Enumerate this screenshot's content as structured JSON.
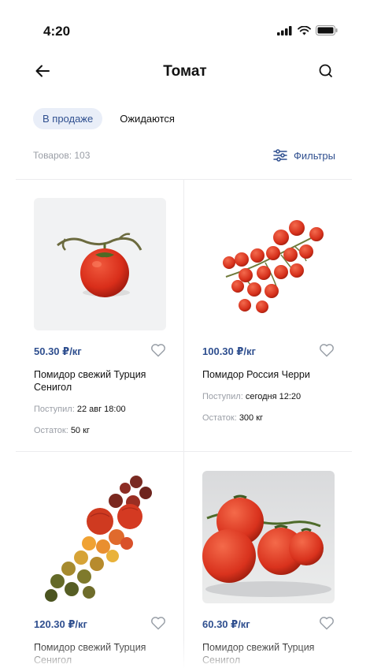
{
  "status": {
    "time": "4:20"
  },
  "header": {
    "title": "Томат"
  },
  "tabs": [
    {
      "label": "В продаже"
    },
    {
      "label": "Ожидаются"
    }
  ],
  "toolbar": {
    "count_label": "Товаров: 103",
    "filters_label": "Фильтры"
  },
  "colors": {
    "accent": "#2f4f8f",
    "chip_bg": "#e9eef8",
    "muted": "#9a9ea6"
  },
  "products": [
    {
      "price": "50.30 ₽/кг",
      "name": "Помидор свежий Турция Сенигол",
      "arrived_label": "Поступил:",
      "arrived_value": "22 авг 18:00",
      "stock_label": "Остаток:",
      "stock_value": "50 кг"
    },
    {
      "price": "100.30 ₽/кг",
      "name": "Помидор  Россия Черри",
      "arrived_label": "Поступил:",
      "arrived_value": "сегодня 12:20",
      "stock_label": "Остаток:",
      "stock_value": "300 кг"
    },
    {
      "price": "120.30 ₽/кг",
      "name": "Помидор свежий Турция Сенигол"
    },
    {
      "price": "60.30 ₽/кг",
      "name": "Помидор свежий Турция Сенигол"
    }
  ]
}
